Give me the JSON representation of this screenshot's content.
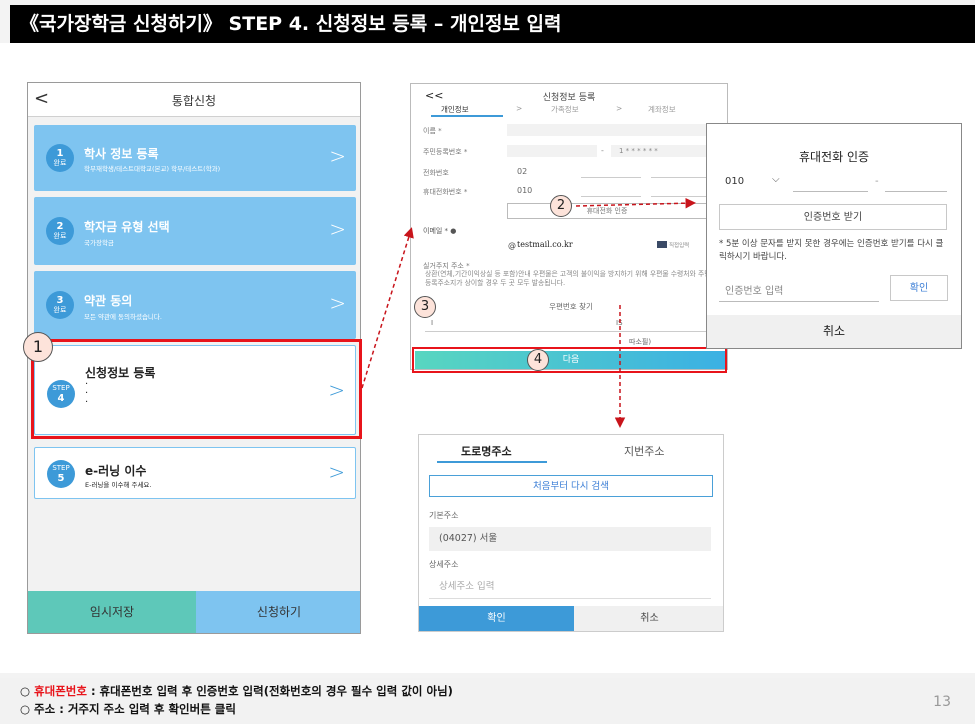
{
  "slide_title": "《국가장학금 신청하기》 STEP 4. 신청정보 등록 – 개인정보 입력",
  "phone": {
    "back": "<",
    "header_title": "통합신청",
    "cards": [
      {
        "badge_num": "1",
        "badge_sub": "완료",
        "title": "학사 정보 등록",
        "subtitle": "학부재학생/테스트대학교(본교) 학부/테스트(학과)"
      },
      {
        "badge_num": "2",
        "badge_sub": "완료",
        "title": "학자금 유형 선택",
        "subtitle": "국가장학금"
      },
      {
        "badge_num": "3",
        "badge_sub": "완료",
        "title": "약관 동의",
        "subtitle": "모든 약관에 동의하셨습니다."
      },
      {
        "badge_num": "4",
        "badge_sub": "STEP",
        "title": "신청정보 등록",
        "subtitle": "·\n·\n·"
      },
      {
        "badge_num": "5",
        "badge_sub": "STEP",
        "title": "e-러닝 이수",
        "subtitle": "E-러닝을 이수해 주세요."
      }
    ],
    "chevron": ">",
    "save_label": "임시저장",
    "apply_label": "신청하기"
  },
  "callouts": {
    "one": "1",
    "two": "2",
    "three": "3",
    "four": "4"
  },
  "form": {
    "back": "<<",
    "title": "신청정보 등록",
    "tabs": [
      "개인정보",
      ">",
      "가족정보",
      ">",
      "계좌정보"
    ],
    "name_label": "이름 *",
    "rrn_label": "주민등록번호 *",
    "rrn_dash": "-",
    "rrn_masked": "1 * * * * * *",
    "tel_label": "전화번호",
    "tel_prefix": "02",
    "mobile_label": "휴대전화번호 *",
    "mobile_prefix": "010",
    "verify_btn": "휴대전화 인증",
    "email_label": "이메일 * ●",
    "email_at": "@",
    "email_domain": "testmail.co.kr",
    "email_direct": "직접입력",
    "addr_label": "실거주지 주소 *",
    "addr_notice": "상환(연체,기간이익상실 등 포함)안내 우편물은 고객의 불이익을 방지하기 위해 우편물 수령처와 주민등록주소지가 상이할 경우 두 곳 모두 발송됩니다.",
    "zip_btn": "우편번호 찾기",
    "addr_row_a": "I",
    "addr_row_b": "IS",
    "addr_row_c": "따소필)",
    "next_label": "다음"
  },
  "dialog": {
    "title": "휴대전화 인증",
    "prefix": "010",
    "chevron": "⌵",
    "dash1": "-",
    "dash2": "-",
    "request_btn": "인증번호 받기",
    "notice": "* 5분 이상 문자를 받지 못한 경우에는 인증번호 받기를 다시 클릭하시기 바랍니다.",
    "code_placeholder": "인증번호 입력",
    "confirm_btn": "확인",
    "cancel_btn": "취소"
  },
  "address": {
    "tab_road": "도로명주소",
    "tab_lot": "지번주소",
    "research_btn": "처음부터 다시 검색",
    "base_label": "기본주소",
    "base_value": "(04027) 서울",
    "detail_label": "상세주소",
    "detail_placeholder": "상세주소 입력",
    "confirm_btn": "확인",
    "cancel_btn": "취소"
  },
  "notes": [
    {
      "bullet": "○ ",
      "highlight": "휴대폰번호",
      "text": " : 휴대폰번호 입력 후 인증번호 입력(전화번호의 경우 필수 입력 값이 아님)"
    },
    {
      "bullet": "○ ",
      "highlight": "",
      "text": "주소 : 거주지 주소 입력 후 확인버튼 클릭"
    }
  ],
  "page_number": "13",
  "colors": {
    "accent_red": "#e8141b",
    "card_blue": "#7ec4f0",
    "badge_blue": "#3d9ad8",
    "next_grad_start": "#58d6c0",
    "next_grad_end": "#3bb0e4"
  }
}
